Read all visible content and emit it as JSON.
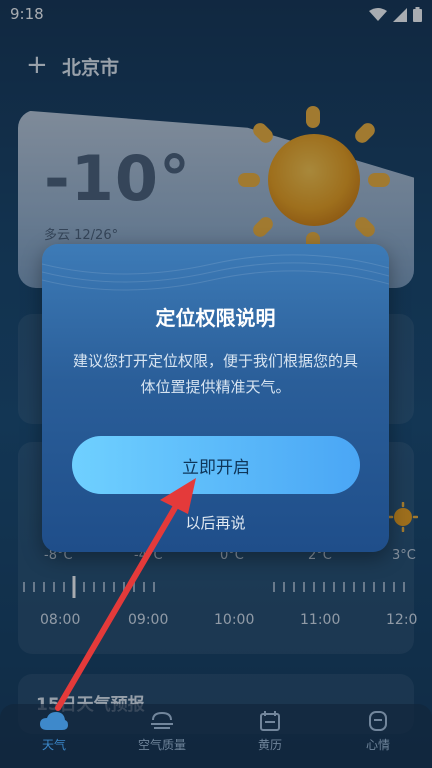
{
  "status_bar": {
    "time": "9:18"
  },
  "header": {
    "add_symbol": "+",
    "city": "北京市"
  },
  "weather_card": {
    "temperature": "-10°",
    "condition": "多云 12/26°"
  },
  "hourly": {
    "temps": [
      "-8°C",
      "-4°C",
      "0°C",
      "2°C",
      "3°C"
    ],
    "times": [
      "08:00",
      "09:00",
      "10:00",
      "11:00",
      "12:0"
    ]
  },
  "section_title": "15日天气预报",
  "dialog": {
    "title": "定位权限说明",
    "body": "建议您打开定位权限，便于我们根据您的具体位置提供精准天气。",
    "primary_button": "立即开启",
    "secondary_button": "以后再说"
  },
  "bottom_nav": {
    "items": [
      {
        "label": "天气",
        "icon": "cloud-icon",
        "active": true
      },
      {
        "label": "空气质量",
        "icon": "air-quality-icon",
        "active": false
      },
      {
        "label": "黄历",
        "icon": "calendar-icon",
        "active": false
      },
      {
        "label": "心情",
        "icon": "mood-icon",
        "active": false
      }
    ]
  },
  "colors": {
    "accent": "#4aa6f5",
    "arrow": "#e43a3a",
    "active_nav": "#4aa6f5"
  }
}
